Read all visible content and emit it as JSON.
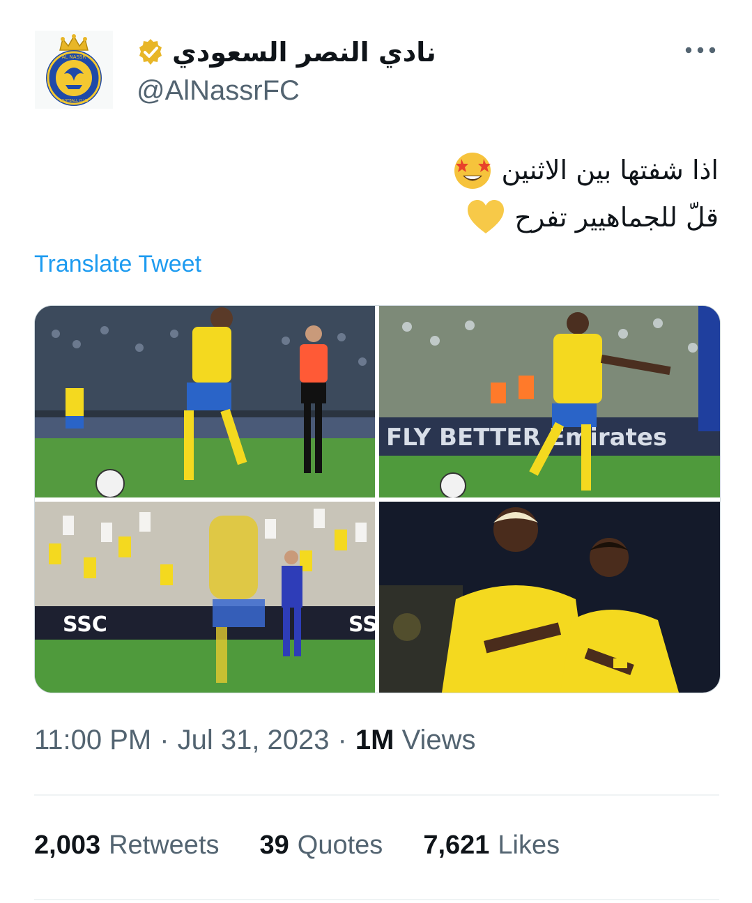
{
  "account": {
    "display_name": "نادي النصر السعودي",
    "handle": "@AlNassrFC",
    "verified_color": "#e8b628",
    "avatar_icon": "al-nassr-crest-icon",
    "avatar_crest_text": "AL NASSR",
    "avatar_crest_subtext": "FOOTBALL CLUB"
  },
  "tweet": {
    "line1": "اذا شفتها بين الاثنين",
    "line1_emoji": "star-struck-emoji-icon",
    "line2": "قلّ للجماهيير تفرح",
    "line2_emoji": "yellow-heart-emoji-icon"
  },
  "translate_label": "Translate Tweet",
  "media": {
    "photos": [
      {
        "icon": "photo-player-dribbling"
      },
      {
        "icon": "photo-player-shooting"
      },
      {
        "icon": "photo-crowd-celebration"
      },
      {
        "icon": "photo-two-players-celebrating"
      }
    ],
    "board_text_1": "FLY BETTER  Emirates",
    "board_text_2": "SSC"
  },
  "meta": {
    "time": "11:00 PM",
    "sep1": "·",
    "date": "Jul 31, 2023",
    "sep2": "·",
    "views_count": "1M",
    "views_label": "Views"
  },
  "stats": {
    "retweets_count": "2,003",
    "retweets_label": "Retweets",
    "quotes_count": "39",
    "quotes_label": "Quotes",
    "likes_count": "7,621",
    "likes_label": "Likes"
  },
  "colors": {
    "accent": "#1d9bf0",
    "text_primary": "#0f1419",
    "text_secondary": "#536471",
    "kit_yellow": "#f4d91f",
    "kit_blue": "#2a64c8"
  }
}
